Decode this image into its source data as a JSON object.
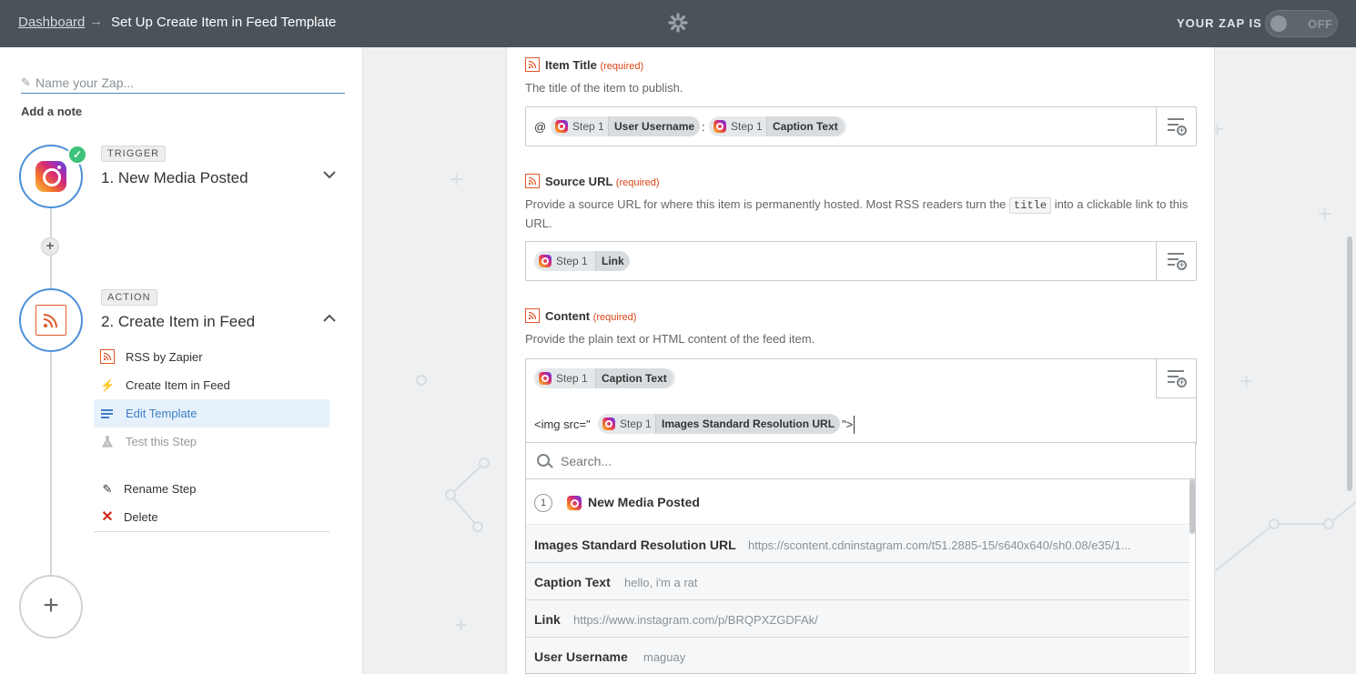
{
  "topbar": {
    "dashboard_link": "Dashboard",
    "arrow": "→",
    "page_title": "Set Up Create Item in Feed Template",
    "zap_status_label": "YOUR ZAP IS",
    "toggle_label": "OFF"
  },
  "sidebar": {
    "zap_name_placeholder": "Name your Zap...",
    "add_note": "Add a note",
    "trigger": {
      "tag": "TRIGGER",
      "title": "1. New Media Posted",
      "check": "✓"
    },
    "action": {
      "tag": "ACTION",
      "title": "2. Create Item in Feed",
      "items": [
        {
          "label": "RSS by Zapier"
        },
        {
          "label": "Create Item in Feed"
        },
        {
          "label": "Edit Template"
        },
        {
          "label": "Test this Step"
        }
      ],
      "rename": "Rename Step",
      "delete": "Delete"
    },
    "add_step_symbol": "+"
  },
  "form": {
    "item_title": {
      "label": "Item Title",
      "required": "(required)",
      "description": "The title of the item to publish.",
      "prefix": "@",
      "separator": ":",
      "pills": [
        {
          "step": "Step 1",
          "field": "User Username"
        },
        {
          "step": "Step 1",
          "field": "Caption Text"
        }
      ]
    },
    "source_url": {
      "label": "Source URL",
      "required": "(required)",
      "description_before": "Provide a source URL for where this item is permanently hosted. Most RSS readers turn the",
      "code": "title",
      "description_after": "into a clickable link to this URL.",
      "pills": [
        {
          "step": "Step 1",
          "field": "Link"
        }
      ]
    },
    "content": {
      "label": "Content",
      "required": "(required)",
      "description": "Provide the plain text or HTML content of the feed item.",
      "pills": [
        {
          "step": "Step 1",
          "field": "Caption Text"
        }
      ],
      "line2_prefix": "<img src=\"",
      "line2_pill": {
        "step": "Step 1",
        "field": "Images Standard Resolution URL"
      },
      "line2_suffix": "\">"
    }
  },
  "dropdown": {
    "search_placeholder": "Search...",
    "group_number": "1",
    "group_title": "New Media Posted",
    "rows": [
      {
        "key": "Images Standard Resolution URL",
        "value": "https://scontent.cdninstagram.com/t51.2885-15/s640x640/sh0.08/e35/1..."
      },
      {
        "key": "Caption Text",
        "value": "hello, i'm a rat"
      },
      {
        "key": "Link",
        "value": "https://www.instagram.com/p/BRQPXZGDFAk/"
      },
      {
        "key": "User Username",
        "value": "maguay"
      }
    ]
  },
  "colors": {
    "topbar": "#4a5359",
    "accent_blue": "#4a90d9",
    "required_red": "#d84315",
    "rss_orange": "#e0582a",
    "success_green": "#3cc27a"
  }
}
